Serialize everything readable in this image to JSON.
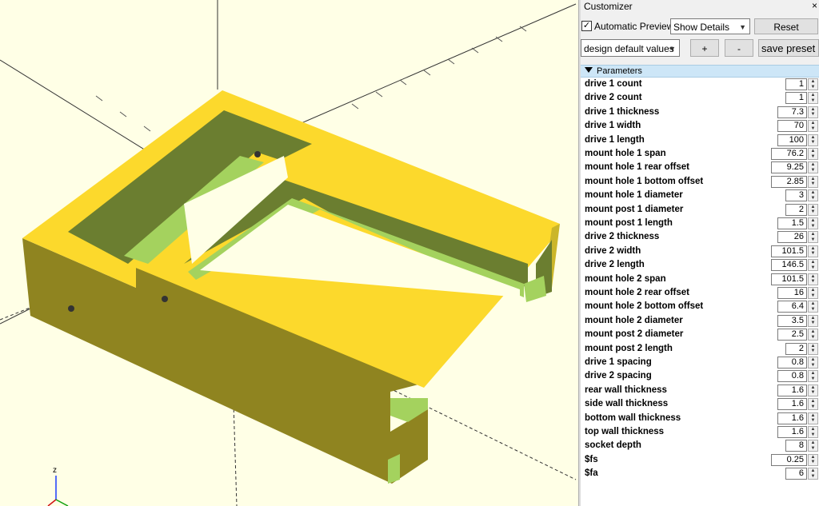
{
  "customizer": {
    "title": "Customizer",
    "close_icon": "×",
    "automatic_preview_checked": true,
    "automatic_preview_label": "Automatic Preview",
    "details_select": "Show Details",
    "reset_label": "Reset",
    "preset_select": "design default values",
    "add_label": "+",
    "remove_label": "-",
    "save_preset_label": "save preset",
    "parameters_header": "Parameters"
  },
  "viewport": {
    "axis_z_label": "z",
    "colors": {
      "top": "#fcd92c",
      "front": "#8f8420",
      "side": "#cbb62a",
      "inner_dark": "#6b7e30",
      "inner_light": "#a4d25e"
    }
  },
  "parameters": [
    {
      "name": "drive 1 count",
      "value": "1"
    },
    {
      "name": "drive 2 count",
      "value": "1"
    },
    {
      "name": "drive 1 thickness",
      "value": "7.3"
    },
    {
      "name": "drive 1 width",
      "value": "70"
    },
    {
      "name": "drive 1 length",
      "value": "100"
    },
    {
      "name": "mount hole 1 span",
      "value": "76.2"
    },
    {
      "name": "mount hole 1 rear offset",
      "value": "9.25"
    },
    {
      "name": "mount hole 1 bottom offset",
      "value": "2.85"
    },
    {
      "name": "mount hole 1 diameter",
      "value": "3"
    },
    {
      "name": "mount post 1 diameter",
      "value": "2"
    },
    {
      "name": "mount post 1 length",
      "value": "1.5"
    },
    {
      "name": "drive 2 thickness",
      "value": "26"
    },
    {
      "name": "drive 2 width",
      "value": "101.5"
    },
    {
      "name": "drive 2 length",
      "value": "146.5"
    },
    {
      "name": "mount hole 2 span",
      "value": "101.5"
    },
    {
      "name": "mount hole 2 rear offset",
      "value": "16"
    },
    {
      "name": "mount hole 2 bottom offset",
      "value": "6.4"
    },
    {
      "name": "mount hole 2 diameter",
      "value": "3.5"
    },
    {
      "name": "mount post 2 diameter",
      "value": "2.5"
    },
    {
      "name": "mount post 2 length",
      "value": "2"
    },
    {
      "name": "drive 1 spacing",
      "value": "0.8"
    },
    {
      "name": "drive 2 spacing",
      "value": "0.8"
    },
    {
      "name": "rear wall thickness",
      "value": "1.6"
    },
    {
      "name": "side wall thickness",
      "value": "1.6"
    },
    {
      "name": "bottom wall thickness",
      "value": "1.6"
    },
    {
      "name": "top wall thickness",
      "value": "1.6"
    },
    {
      "name": "socket depth",
      "value": "8"
    },
    {
      "name": "$fs",
      "value": "0.25"
    },
    {
      "name": "$fa",
      "value": "6"
    }
  ]
}
